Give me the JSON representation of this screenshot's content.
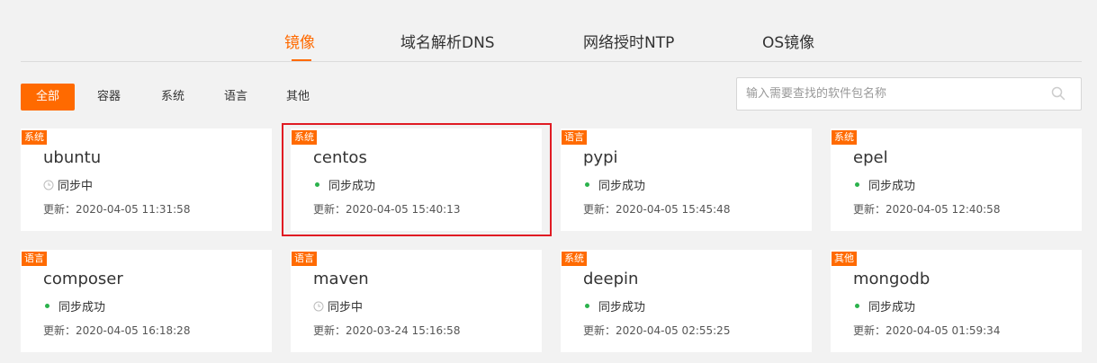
{
  "nav": {
    "tabs": [
      {
        "label": "镜像"
      },
      {
        "label": "域名解析DNS"
      },
      {
        "label": "网络授时NTP"
      },
      {
        "label": "OS镜像"
      }
    ]
  },
  "filters": [
    {
      "label": "全部"
    },
    {
      "label": "容器"
    },
    {
      "label": "系统"
    },
    {
      "label": "语言"
    },
    {
      "label": "其他"
    }
  ],
  "search": {
    "placeholder": "输入需要查找的软件包名称",
    "value": ""
  },
  "cards": [
    {
      "tag": "系统",
      "title": "ubuntu",
      "status": "同步中",
      "updated": "更新：2020-04-05 11:31:58"
    },
    {
      "tag": "系统",
      "title": "centos",
      "status": "同步成功",
      "updated": "更新：2020-04-05 15:40:13"
    },
    {
      "tag": "语言",
      "title": "pypi",
      "status": "同步成功",
      "updated": "更新：2020-04-05 15:45:48"
    },
    {
      "tag": "系统",
      "title": "epel",
      "status": "同步成功",
      "updated": "更新：2020-04-05 12:40:58"
    },
    {
      "tag": "语言",
      "title": "composer",
      "status": "同步成功",
      "updated": "更新：2020-04-05 16:18:28"
    },
    {
      "tag": "语言",
      "title": "maven",
      "status": "同步中",
      "updated": "更新：2020-03-24 15:16:58"
    },
    {
      "tag": "系统",
      "title": "deepin",
      "status": "同步成功",
      "updated": "更新：2020-04-05 02:55:25"
    },
    {
      "tag": "其他",
      "title": "mongodb",
      "status": "同步成功",
      "updated": "更新：2020-04-05 01:59:34"
    }
  ],
  "colors": {
    "accent": "#ff6a00",
    "success": "#2bb24c",
    "highlight": "#e01b23"
  },
  "icons": {
    "syncing": "clock-icon",
    "success": "green-dot",
    "search": "search-icon"
  }
}
